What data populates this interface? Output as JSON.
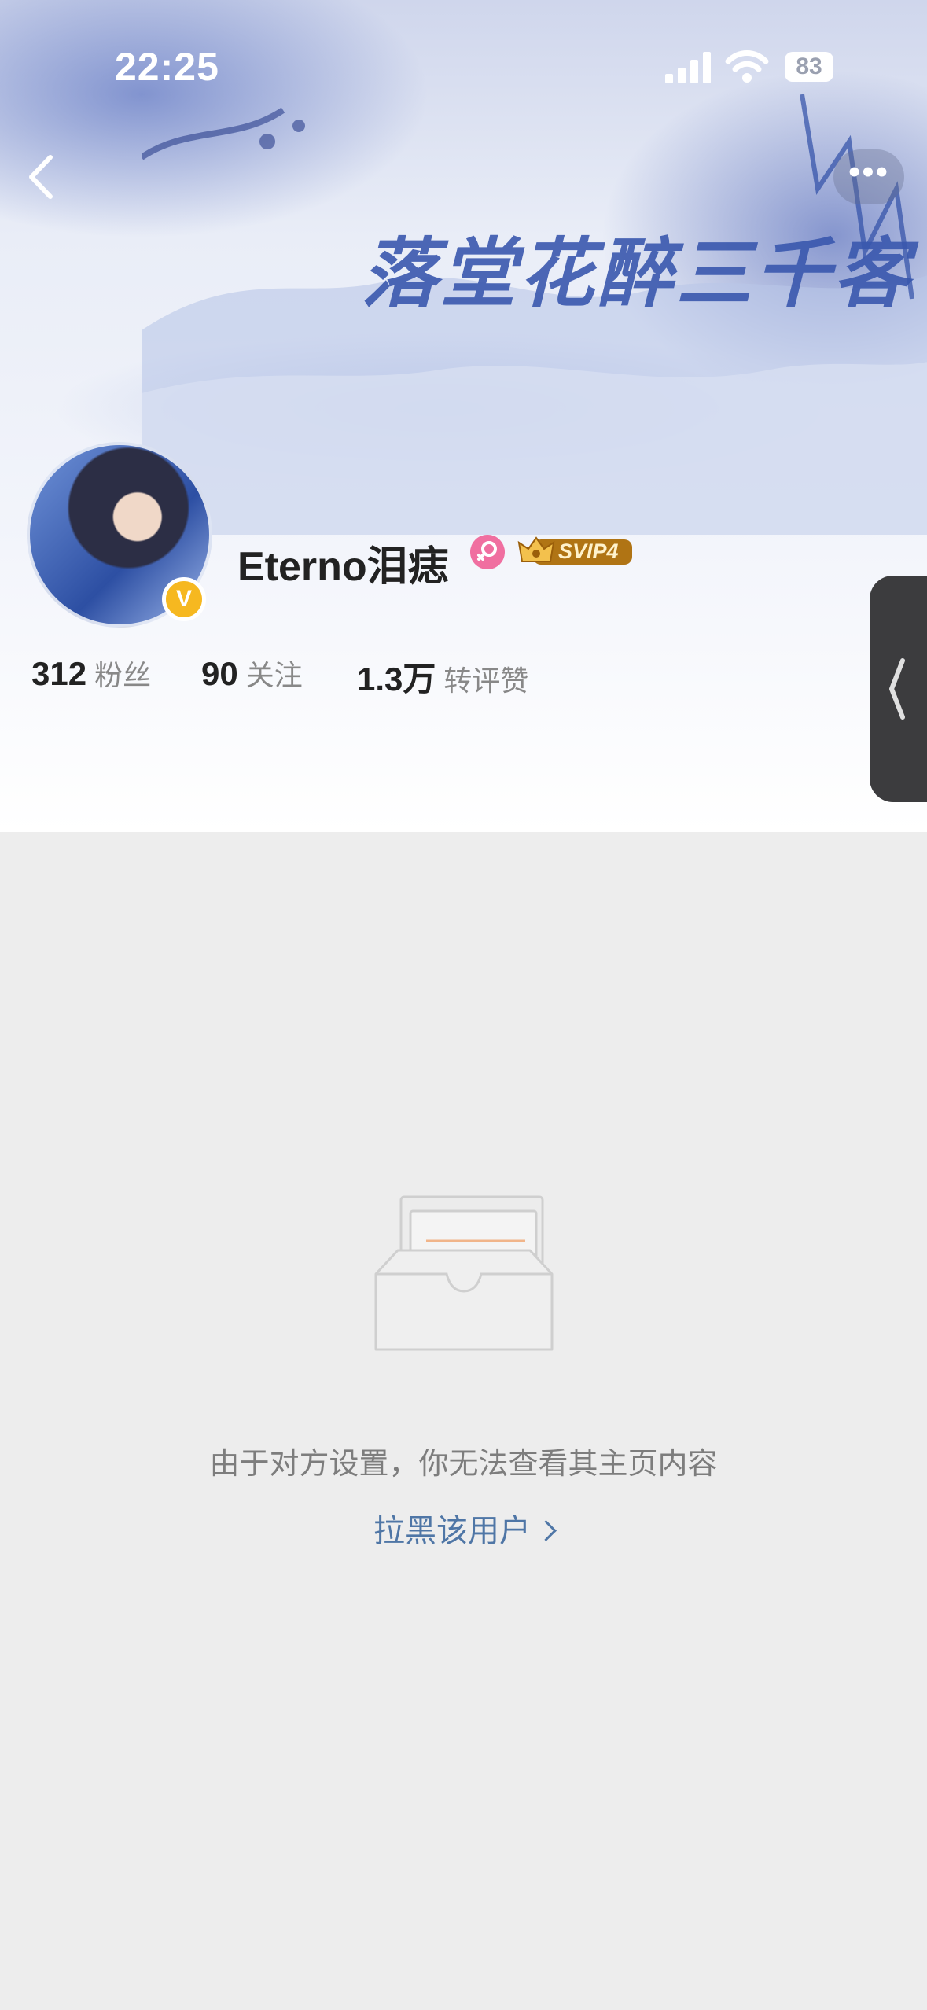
{
  "status_bar": {
    "time": "22:25",
    "battery": "83"
  },
  "banner": {
    "title": "落堂花醉三千客"
  },
  "profile": {
    "username": "Eterno泪痣",
    "verified_mark": "V",
    "vip_badge": "SVIP4"
  },
  "stats": [
    {
      "value": "312",
      "label": "粉丝"
    },
    {
      "value": "90",
      "label": "关注"
    },
    {
      "value": "1.3万",
      "label": "转评赞"
    }
  ],
  "empty_state": {
    "message": "由于对方设置，你无法查看其主页内容",
    "action": "拉黑该用户"
  },
  "colors": {
    "accent_link": "#4f76a6",
    "verified": "#f6b820",
    "vip_gold": "#c98a16",
    "female": "#f06fa0"
  },
  "icons": [
    "back-icon",
    "more-icon",
    "signal-icon",
    "wifi-icon",
    "battery-icon",
    "female-icon",
    "crown-icon",
    "empty-inbox-icon",
    "chevron-right-icon",
    "side-collapse-icon"
  ]
}
